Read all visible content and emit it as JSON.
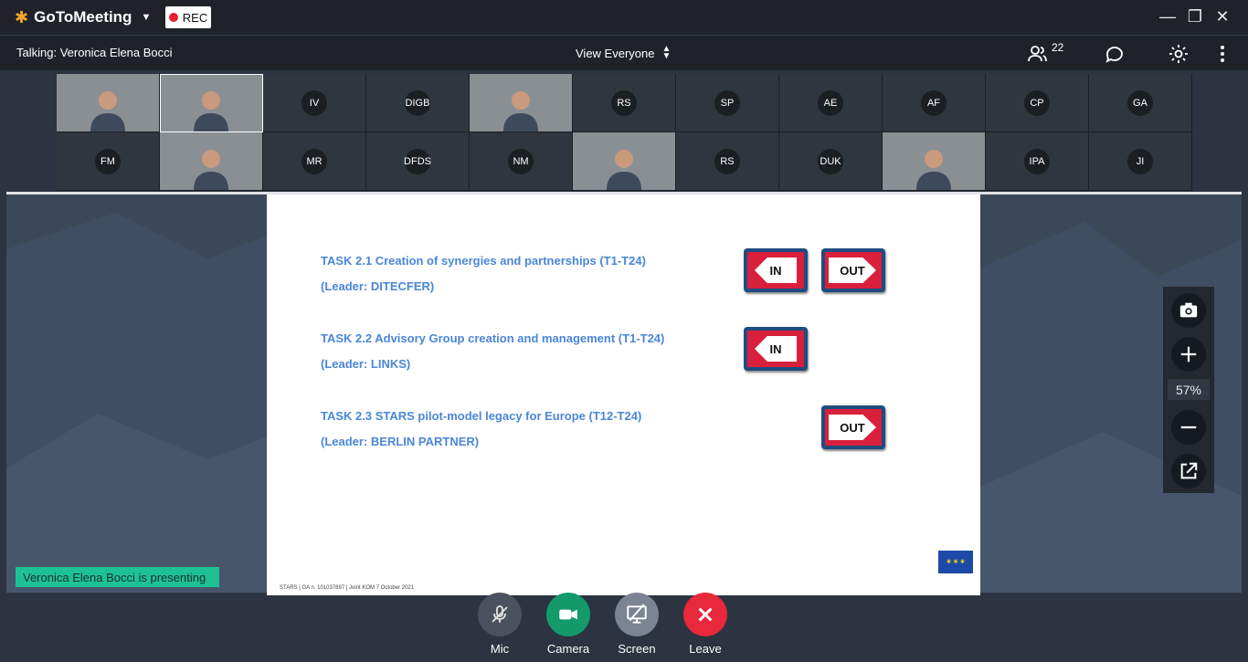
{
  "app": {
    "name": "GoToMeeting",
    "rec_label": "REC"
  },
  "toolbar": {
    "talking": "Talking: Veronica Elena Bocci",
    "view_mode": "View Everyone",
    "participants_count": "22"
  },
  "participants": [
    {
      "initials": "",
      "video": true
    },
    {
      "initials": "",
      "video": true
    },
    {
      "initials": "IV",
      "video": false
    },
    {
      "initials": "DIGB",
      "video": false
    },
    {
      "initials": "",
      "video": true
    },
    {
      "initials": "RS",
      "video": false
    },
    {
      "initials": "SP",
      "video": false
    },
    {
      "initials": "AE",
      "video": false
    },
    {
      "initials": "AF",
      "video": false
    },
    {
      "initials": "CP",
      "video": false
    },
    {
      "initials": "GA",
      "video": false
    },
    {
      "initials": "FM",
      "video": false
    },
    {
      "initials": "",
      "video": true
    },
    {
      "initials": "MR",
      "video": false
    },
    {
      "initials": "DFDS",
      "video": false
    },
    {
      "initials": "NM",
      "video": false
    },
    {
      "initials": "",
      "video": true
    },
    {
      "initials": "RS",
      "video": false
    },
    {
      "initials": "DUK",
      "video": false
    },
    {
      "initials": "",
      "video": true
    },
    {
      "initials": "IPA",
      "video": false
    },
    {
      "initials": "JI",
      "video": false
    }
  ],
  "slide": {
    "tasks": [
      {
        "line1": "TASK 2.1 Creation of synergies and partnerships (T1-T24)",
        "line2": "(Leader: DITECFER)"
      },
      {
        "line1": "TASK 2.2 Advisory Group creation and management (T1-T24)",
        "line2": "(Leader: LINKS)"
      },
      {
        "line1": "TASK 2.3 STARS pilot-model legacy for Europe (T12-T24)",
        "line2": "(Leader: BERLIN PARTNER)"
      }
    ],
    "in_label": "IN",
    "out_label": "OUT",
    "footer": "STARS | GA n. 101037897 | Joint KOM 7 October 2021"
  },
  "side_panel": {
    "zoom": "57%"
  },
  "presenting_banner": "Veronica Elena Bocci is presenting",
  "controls": {
    "mic": "Mic",
    "camera": "Camera",
    "screen": "Screen",
    "leave": "Leave"
  },
  "colors": {
    "camera": "#149a6a",
    "leave": "#e8283b",
    "presenting": "#1ec196",
    "task_text": "#4a86d8"
  }
}
